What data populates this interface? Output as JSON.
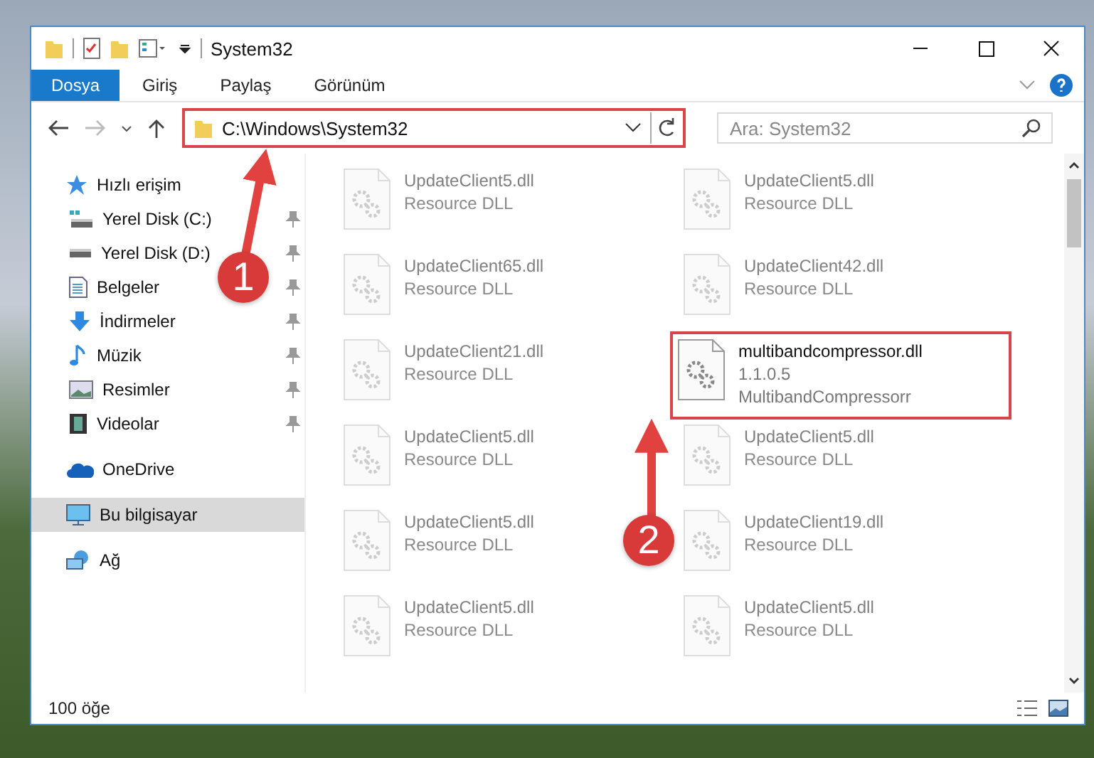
{
  "window": {
    "title": "System32"
  },
  "ribbon": {
    "tabs": [
      {
        "label": "Dosya",
        "selected": true
      },
      {
        "label": "Giriş",
        "selected": false
      },
      {
        "label": "Paylaş",
        "selected": false
      },
      {
        "label": "Görünüm",
        "selected": false
      }
    ]
  },
  "address_bar": {
    "path": "C:\\Windows\\System32",
    "annotated": true
  },
  "search": {
    "placeholder": "Ara: System32"
  },
  "sidebar": {
    "items": [
      {
        "label": "Hızlı erişim",
        "kind": "star",
        "selected": false,
        "children": [
          {
            "label": "Yerel Disk (C:)",
            "kind": "system-drive",
            "pinned": true
          },
          {
            "label": "Yerel Disk (D:)",
            "kind": "drive",
            "pinned": true
          },
          {
            "label": "Belgeler",
            "kind": "documents",
            "pinned": true
          },
          {
            "label": "İndirmeler",
            "kind": "downloads",
            "pinned": true
          },
          {
            "label": "Müzik",
            "kind": "music",
            "pinned": true
          },
          {
            "label": "Resimler",
            "kind": "pictures",
            "pinned": true
          },
          {
            "label": "Videolar",
            "kind": "videos",
            "pinned": true
          }
        ]
      },
      {
        "label": "OneDrive",
        "kind": "cloud",
        "selected": false
      },
      {
        "label": "Bu bilgisayar",
        "kind": "computer",
        "selected": true
      },
      {
        "label": "Ağ",
        "kind": "network",
        "selected": false
      }
    ]
  },
  "files": [
    {
      "name": "UpdateClient5.dll",
      "lines": [
        "Resource DLL"
      ],
      "blurred": true,
      "annotated": false
    },
    {
      "name": "UpdateClient5.dll",
      "lines": [
        "Resource DLL"
      ],
      "blurred": true,
      "annotated": false
    },
    {
      "name": "UpdateClient65.dll",
      "lines": [
        "Resource DLL"
      ],
      "blurred": true,
      "annotated": false
    },
    {
      "name": "UpdateClient42.dll",
      "lines": [
        "Resource DLL"
      ],
      "blurred": true,
      "annotated": false
    },
    {
      "name": "UpdateClient21.dll",
      "lines": [
        "Resource DLL"
      ],
      "blurred": true,
      "annotated": false
    },
    {
      "name": "multibandcompressor.dll",
      "lines": [
        "1.1.0.5",
        "MultibandCompressorr"
      ],
      "blurred": false,
      "annotated": true
    },
    {
      "name": "UpdateClient5.dll",
      "lines": [
        "Resource DLL"
      ],
      "blurred": true,
      "annotated": false
    },
    {
      "name": "UpdateClient5.dll",
      "lines": [
        "Resource DLL"
      ],
      "blurred": true,
      "annotated": false
    },
    {
      "name": "UpdateClient5.dll",
      "lines": [
        "Resource DLL"
      ],
      "blurred": true,
      "annotated": false
    },
    {
      "name": "UpdateClient19.dll",
      "lines": [
        "Resource DLL"
      ],
      "blurred": true,
      "annotated": false
    },
    {
      "name": "UpdateClient5.dll",
      "lines": [
        "Resource DLL"
      ],
      "blurred": true,
      "annotated": false
    },
    {
      "name": "UpdateClient5.dll",
      "lines": [
        "Resource DLL"
      ],
      "blurred": true,
      "annotated": false
    }
  ],
  "status_bar": {
    "count": "100 öğe"
  },
  "annotations": [
    {
      "number": "1"
    },
    {
      "number": "2"
    }
  ]
}
